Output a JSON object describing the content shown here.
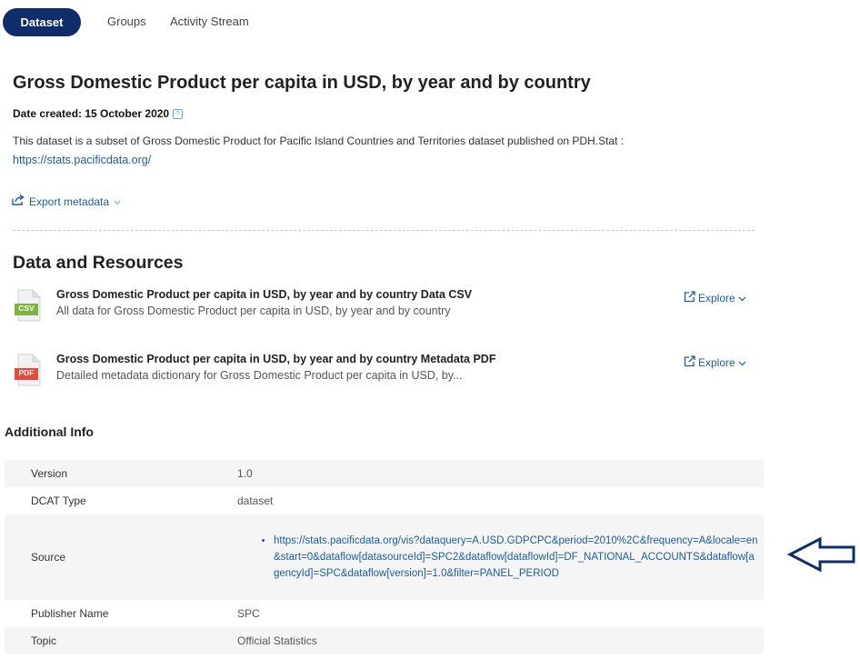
{
  "tabs": [
    {
      "label": "Dataset",
      "active": true
    },
    {
      "label": "Groups",
      "active": false
    },
    {
      "label": "Activity Stream",
      "active": false
    }
  ],
  "dataset": {
    "title": "Gross Domestic Product per capita in USD, by year and by country",
    "date_created": "Date created: 15 October 2020",
    "description": "This dataset is a subset of Gross Domestic Product for Pacific Island Countries and Territories dataset published on PDH.Stat :",
    "link": "https://stats.pacificdata.org/",
    "export_label": "Export metadata"
  },
  "resources_section": {
    "title": "Data and Resources",
    "items": [
      {
        "format": "CSV",
        "format_color": "#7cb342",
        "title": "Gross Domestic Product per capita in USD, by year and by country Data CSV",
        "description": "All data for Gross Domestic Product per capita in USD, by year and by country",
        "action": "Explore"
      },
      {
        "format": "PDF",
        "format_color": "#e64a3b",
        "title": "Gross Domestic Product per capita in USD, by year and by country Metadata PDF",
        "description": "Detailed metadata dictionary for Gross Domestic Product per capita in USD, by...",
        "action": "Explore"
      }
    ]
  },
  "additional_info": {
    "title": "Additional Info",
    "rows": [
      {
        "key": "Version",
        "value": "1.0"
      },
      {
        "key": "DCAT Type",
        "value": "dataset"
      },
      {
        "key": "Source",
        "value": "https://stats.pacificdata.org/vis?dataquery=A.USD.GDPCPC&period=2010%2C&frequency=A&locale=en&start=0&dataflow[datasourceId]=SPC2&dataflow[dataflowId]=DF_NATIONAL_ACCOUNTS&dataflow[agencyId]=SPC&dataflow[version]=1.0&filter=PANEL_PERIOD"
      },
      {
        "key": "Publisher Name",
        "value": "SPC"
      },
      {
        "key": "Topic",
        "value": "Official Statistics"
      }
    ]
  },
  "colors": {
    "accent": "#0f2d6b",
    "link": "#1d5c9c"
  }
}
